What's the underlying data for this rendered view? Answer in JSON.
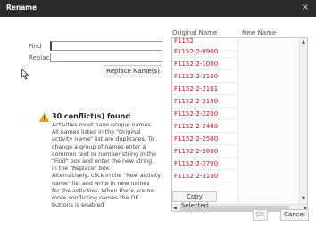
{
  "dialog": {
    "title": "Rename",
    "close_glyph": "×"
  },
  "form": {
    "find_label": "Find",
    "find_value": "",
    "replace_label": "Replace",
    "replace_value": "",
    "replace_button": "Replace Name(s)"
  },
  "conflict": {
    "icon": "warning-icon",
    "title": "30 conflict(s) found",
    "lines": [
      "Activities must have unique names.",
      "All names listed in the \"Original",
      "activity name\" list are duplicates. To",
      "change a group of names enter a",
      "common text or number string in the",
      "\"Find\" box and enter the new string",
      "in the \"Replace\" box.",
      "Alternatively, click in the \"New activity",
      "name\" list and write in new names",
      "for the activities. When there are no",
      "more conflicting names the OK",
      "buttons is enabled"
    ]
  },
  "list": {
    "original_header": "Original Name",
    "new_header": "New Name",
    "original_names": [
      "F1152",
      "F1152-2-0900",
      "F1152-2-1000",
      "F1152-2-2100",
      "F1152-2-2101",
      "F1152-2-2190",
      "F1152-2-2200",
      "F1152-2-2400",
      "F1152-2-2500",
      "F1152-2-2600",
      "F1152-2-2700",
      "F1152-2-3100"
    ],
    "name_color": "#c0181e"
  },
  "buttons": {
    "copy_selected": "Copy Selected",
    "ok": "OK",
    "cancel": "Cancel"
  }
}
